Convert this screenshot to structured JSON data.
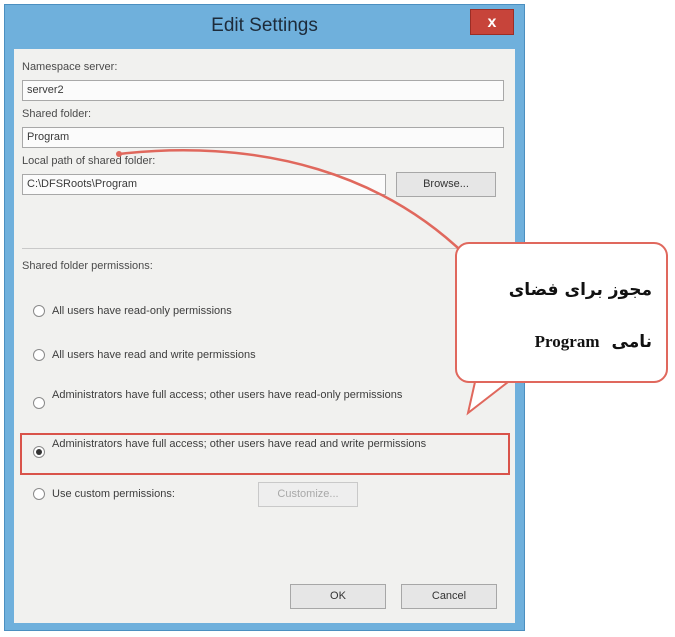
{
  "window": {
    "title": "Edit Settings",
    "close_glyph": "x"
  },
  "form": {
    "namespace_label": "Namespace server:",
    "namespace_value": "server2",
    "shared_folder_label": "Shared folder:",
    "shared_folder_value": "Program",
    "local_path_label": "Local path of shared folder:",
    "local_path_value": "C:\\DFSRoots\\Program",
    "browse_label": "Browse...",
    "permissions_label": "Shared folder permissions:",
    "options": [
      {
        "label": "All users have read-only permissions",
        "selected": false
      },
      {
        "label": "All users have read and write permissions",
        "selected": false
      },
      {
        "label": "Administrators have full access; other users have read-only permissions",
        "selected": false
      },
      {
        "label": "Administrators have full access; other users have read and write permissions",
        "selected": true
      },
      {
        "label": "Use custom permissions:",
        "selected": false
      }
    ],
    "customize_label": "Customize...",
    "ok_label": "OK",
    "cancel_label": "Cancel"
  },
  "annotation": {
    "line1": "مجوز برای فضای",
    "line2_word1": "نامی",
    "line2_word2": "Program",
    "accent_color": "#e0685d"
  }
}
